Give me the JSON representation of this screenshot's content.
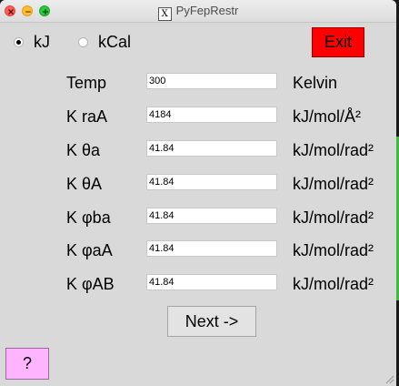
{
  "window": {
    "title": "PyFepRestr"
  },
  "units": {
    "options": [
      {
        "label": "kJ",
        "checked": true
      },
      {
        "label": "kCal",
        "checked": false
      }
    ]
  },
  "exit_label": "Exit",
  "params": [
    {
      "label": "Temp",
      "value": "300",
      "unit": "Kelvin"
    },
    {
      "label": "K raA",
      "value": "4184",
      "unit": "kJ/mol/Å²"
    },
    {
      "label": "K θa",
      "value": "41.84",
      "unit": "kJ/mol/rad²"
    },
    {
      "label": "K θA",
      "value": "41.84",
      "unit": "kJ/mol/rad²"
    },
    {
      "label": "K φba",
      "value": "41.84",
      "unit": "kJ/mol/rad²"
    },
    {
      "label": "K φaA",
      "value": "41.84",
      "unit": "kJ/mol/rad²"
    },
    {
      "label": "K φAB",
      "value": "41.84",
      "unit": "kJ/mol/rad²"
    }
  ],
  "next_label": "Next ->",
  "help_label": "?",
  "colors": {
    "exit": "#ff0000",
    "help": "#ffb4ff",
    "window_bg": "#d9d9d9"
  }
}
